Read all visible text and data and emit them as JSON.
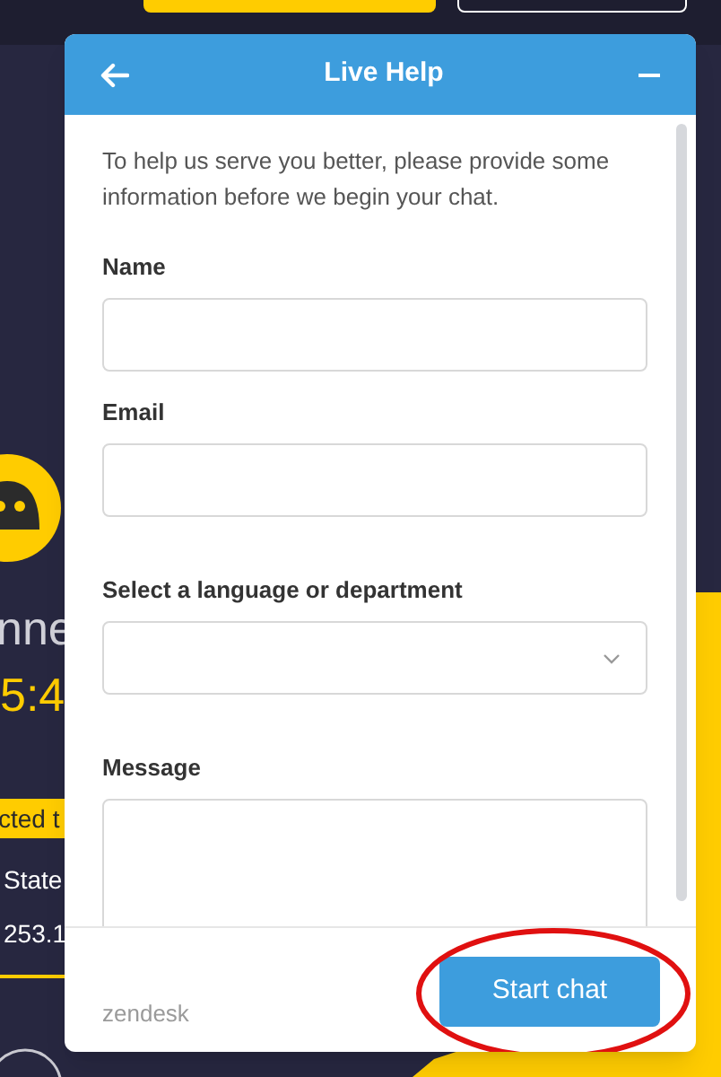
{
  "background_app": {
    "status_text": "nne",
    "timer": "5:4",
    "banner": "cted t",
    "location": "State",
    "address": "253.1"
  },
  "chat_window": {
    "title": "Live Help",
    "intro": "To help us serve you better, please provide some information before we begin your chat.",
    "fields": [
      {
        "kind": "text",
        "label": "Name"
      },
      {
        "kind": "text",
        "label": "Email"
      },
      {
        "kind": "select",
        "label": "Select a language or department"
      },
      {
        "kind": "textarea",
        "label": "Message"
      }
    ],
    "brand": "zendesk",
    "submit": {
      "label": "Start chat",
      "circled": true
    }
  }
}
